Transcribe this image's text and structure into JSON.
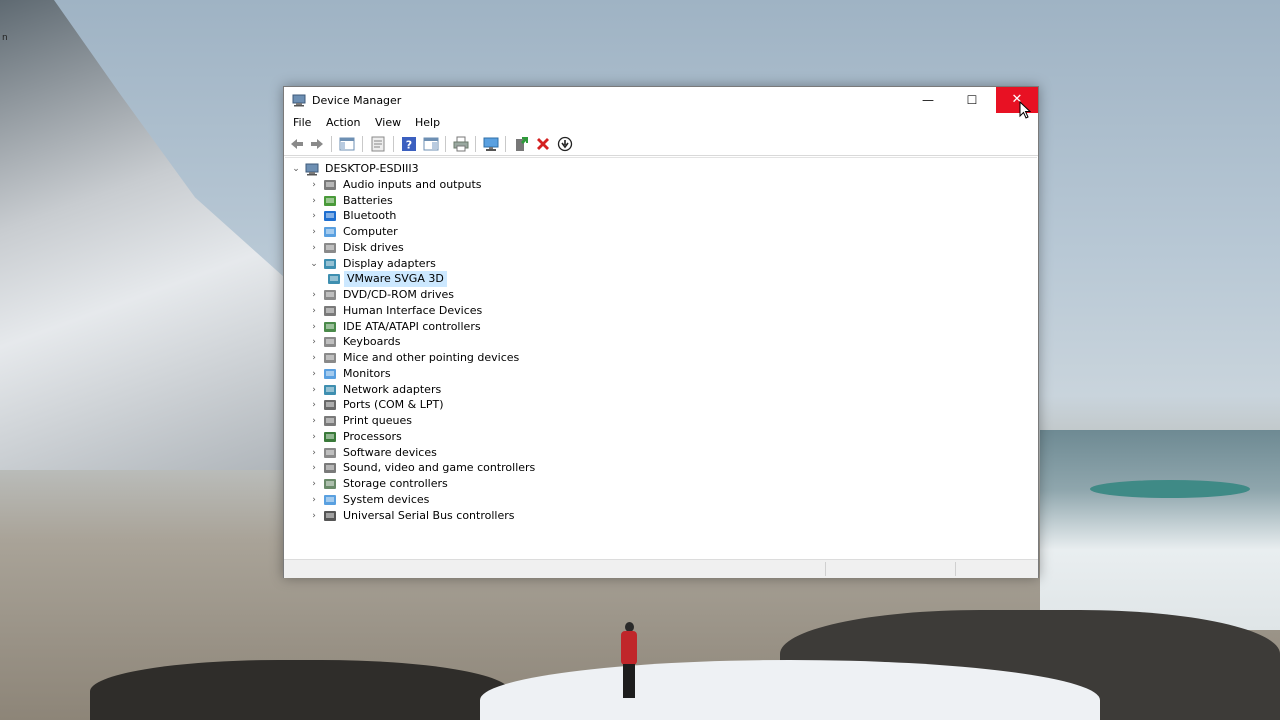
{
  "window": {
    "title": "Device Manager",
    "controls": {
      "minimize": "—",
      "maximize": "☐",
      "close": "✕"
    }
  },
  "menubar": [
    "File",
    "Action",
    "View",
    "Help"
  ],
  "toolbar": [
    {
      "icon": "back-arrow-icon",
      "color": "#7a7a7a"
    },
    {
      "icon": "forward-arrow-icon",
      "color": "#7a7a7a"
    },
    {
      "icon": "show-hide-console-tree-icon",
      "color": "#6d8fb3"
    },
    {
      "icon": "properties-icon",
      "color": "#8a8a8a"
    },
    {
      "icon": "help-icon",
      "color": "#3b5fbf"
    },
    {
      "icon": "action-pane-icon",
      "color": "#6d8fb3"
    },
    {
      "icon": "print-icon",
      "color": "#6b8a6b"
    },
    {
      "icon": "scan-hardware-changes-icon",
      "color": "#2f7fc8"
    },
    {
      "icon": "add-driver-icon",
      "color": "#2e9a3a"
    },
    {
      "icon": "uninstall-device-icon",
      "color": "#d42020"
    },
    {
      "icon": "update-driver-icon",
      "color": "#222222"
    }
  ],
  "tree": {
    "root": "DESKTOP-ESDIII3",
    "categories": [
      {
        "label": "Audio inputs and outputs",
        "icon": "speaker-icon",
        "expanded": false
      },
      {
        "label": "Batteries",
        "icon": "battery-icon",
        "expanded": false
      },
      {
        "label": "Bluetooth",
        "icon": "bluetooth-icon",
        "expanded": false
      },
      {
        "label": "Computer",
        "icon": "computer-icon",
        "expanded": false
      },
      {
        "label": "Disk drives",
        "icon": "disk-drive-icon",
        "expanded": false
      },
      {
        "label": "Display adapters",
        "icon": "display-adapter-icon",
        "expanded": true
      },
      {
        "label": "VMware SVGA 3D",
        "icon": "display-adapter-icon",
        "child": true,
        "selected": true
      },
      {
        "label": "DVD/CD-ROM drives",
        "icon": "optical-drive-icon",
        "expanded": false
      },
      {
        "label": "Human Interface Devices",
        "icon": "hid-icon",
        "expanded": false
      },
      {
        "label": "IDE ATA/ATAPI controllers",
        "icon": "ide-controller-icon",
        "expanded": false
      },
      {
        "label": "Keyboards",
        "icon": "keyboard-icon",
        "expanded": false
      },
      {
        "label": "Mice and other pointing devices",
        "icon": "mouse-icon",
        "expanded": false
      },
      {
        "label": "Monitors",
        "icon": "monitor-icon",
        "expanded": false
      },
      {
        "label": "Network adapters",
        "icon": "network-adapter-icon",
        "expanded": false
      },
      {
        "label": "Ports (COM & LPT)",
        "icon": "port-icon",
        "expanded": false
      },
      {
        "label": "Print queues",
        "icon": "printer-icon",
        "expanded": false
      },
      {
        "label": "Processors",
        "icon": "processor-icon",
        "expanded": false
      },
      {
        "label": "Software devices",
        "icon": "software-device-icon",
        "expanded": false
      },
      {
        "label": "Sound, video and game controllers",
        "icon": "sound-controller-icon",
        "expanded": false
      },
      {
        "label": "Storage controllers",
        "icon": "storage-controller-icon",
        "expanded": false
      },
      {
        "label": "System devices",
        "icon": "system-devices-icon",
        "expanded": false
      },
      {
        "label": "Universal Serial Bus controllers",
        "icon": "usb-icon",
        "expanded": false
      }
    ]
  },
  "colors": {
    "close_button": "#e81123",
    "selection": "#cce8ff",
    "statusbar": "#f0f0f0"
  }
}
